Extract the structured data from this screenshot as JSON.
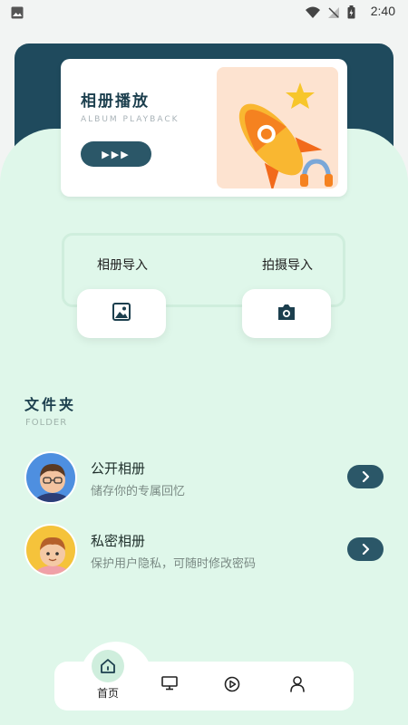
{
  "status_bar": {
    "time": "2:40"
  },
  "banner": {
    "title": "相册播放",
    "subtitle": "ALBUM PLAYBACK",
    "play_label": "▶▶▶"
  },
  "import": {
    "album_label": "相册导入",
    "camera_label": "拍摄导入"
  },
  "folder": {
    "title": "文件夹",
    "subtitle": "FOLDER",
    "items": [
      {
        "title": "公开相册",
        "desc": "储存你的专属回忆"
      },
      {
        "title": "私密相册",
        "desc": "保护用户隐私，可随时修改密码"
      }
    ]
  },
  "nav": {
    "home_label": "首页"
  },
  "colors": {
    "accent": "#2b5768",
    "background": "#dff7ea",
    "dark_panel": "#1f4a5d"
  }
}
